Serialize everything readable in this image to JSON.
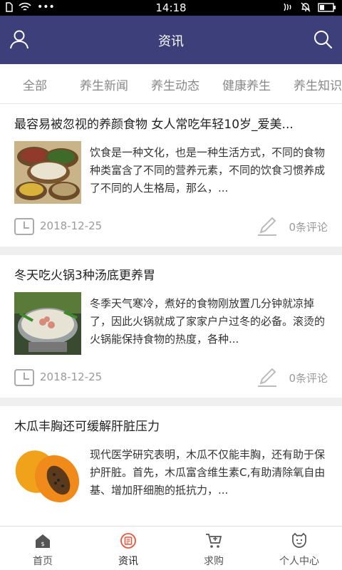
{
  "status_bar": {
    "time": "14:18"
  },
  "header": {
    "title": "资讯"
  },
  "tabs": [
    "全部",
    "养生新闻",
    "养生动态",
    "健康养生",
    "养生知识"
  ],
  "articles": [
    {
      "title": "最容易被忽视的养颜食物 女人常吃年轻10岁_爱美...",
      "description": "饮食是一种文化，也是一种生活方式，不同的食物种类富含了不同的营养元素，不同的饮食习惯养成了不同的人生格局，那么，...",
      "date": "2018-12-25",
      "comments": "0条评论"
    },
    {
      "title": "冬天吃火锅3种汤底更养胃",
      "description": "冬季天气寒冷，煮好的食物刚放置几分钟就凉掉了，因此火锅就成了家家户户过冬的必备。滚烫的火锅能保持食物的热度，各种...",
      "date": "2018-12-25",
      "comments": "0条评论"
    },
    {
      "title": "木瓜丰胸还可缓解肝脏压力",
      "description": "现代医学研究表明，木瓜不仅能丰胸，还有助于保护肝脏。首先，木瓜富含维生素C,有助清除氧自由基、增加肝细胞的抵抗力，...",
      "date": "",
      "comments": ""
    }
  ],
  "bottom_nav": {
    "items": [
      {
        "label": "首页",
        "icon": "home-icon"
      },
      {
        "label": "资讯",
        "icon": "news-icon",
        "active": true
      },
      {
        "label": "求购",
        "icon": "cart-icon"
      },
      {
        "label": "个人中心",
        "icon": "profile-icon"
      }
    ]
  },
  "colors": {
    "header_bg": "#3d3f7a",
    "active_nav": "#e8553b",
    "meta_gray": "#9a9a9a"
  }
}
